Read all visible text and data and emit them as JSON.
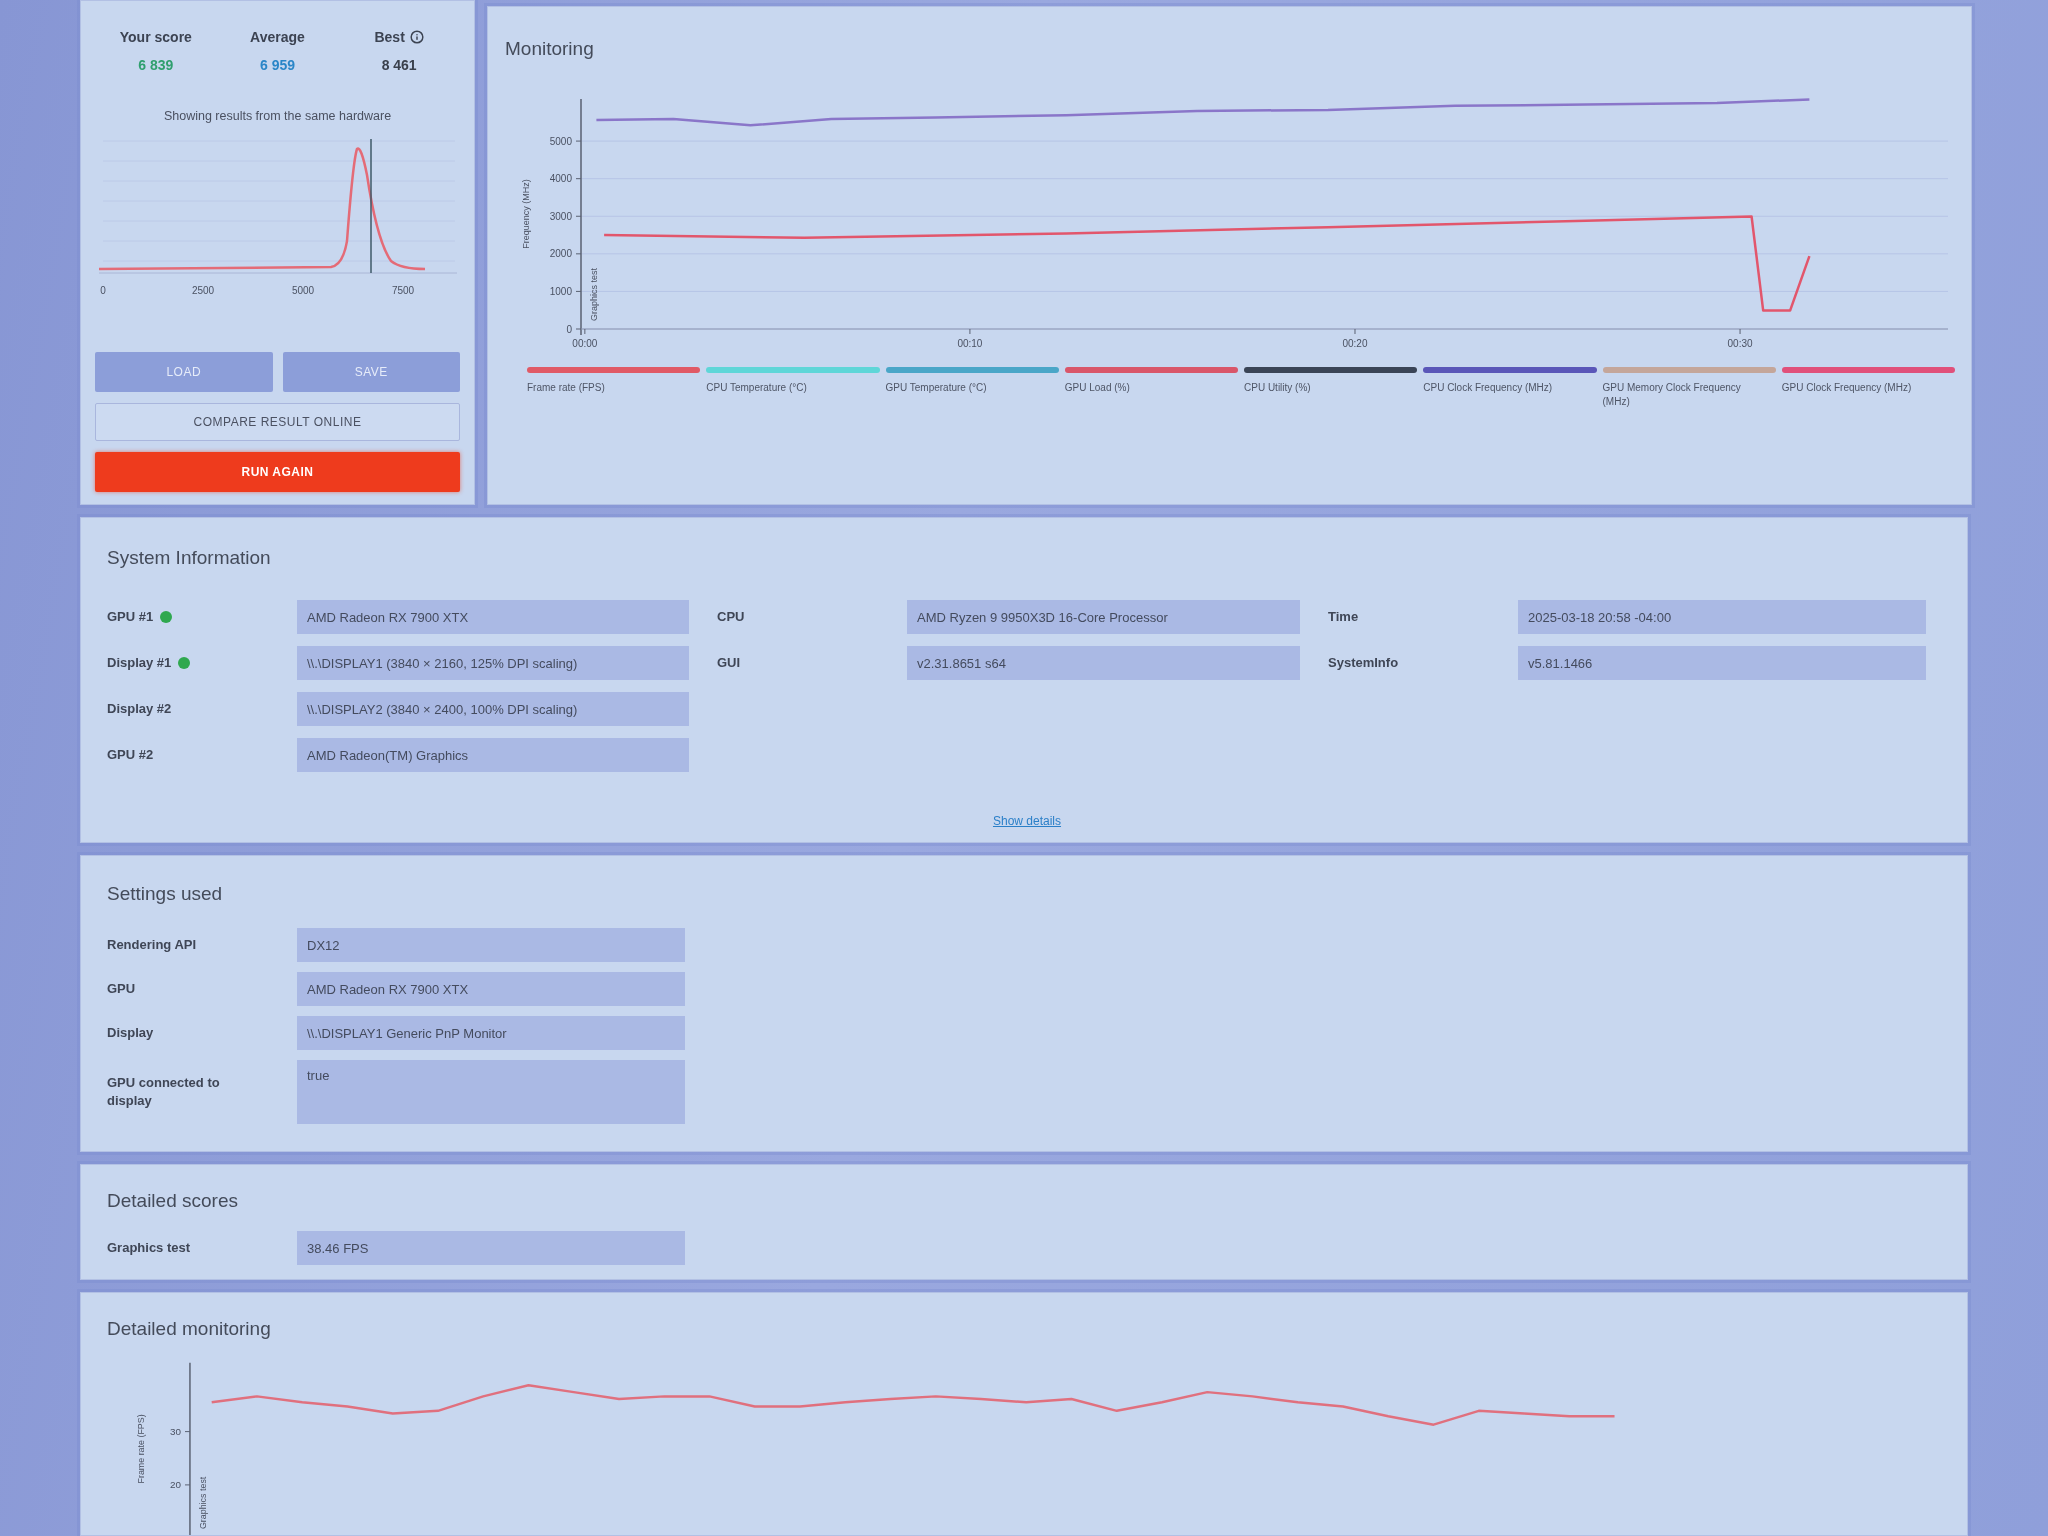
{
  "score_panel": {
    "scores": [
      {
        "kind": "yours",
        "label": "Your score",
        "value": "6 839"
      },
      {
        "kind": "average",
        "label": "Average",
        "value": "6 959"
      },
      {
        "kind": "best",
        "label": "Best",
        "value": "8 461",
        "info": true
      }
    ],
    "distribution": {
      "caption": "Showing results from the same hardware",
      "axis_labels": [
        "0",
        "2500",
        "5000",
        "7500"
      ]
    },
    "buttons": [
      {
        "kind": "secondary",
        "label": "LOAD"
      },
      {
        "kind": "secondary",
        "label": "SAVE"
      },
      {
        "kind": "outline",
        "label": "COMPARE RESULT ONLINE"
      },
      {
        "kind": "primary",
        "label": "RUN AGAIN"
      }
    ]
  },
  "monitoring": {
    "title": "Monitoring",
    "marker_label": "Graphics test",
    "chart_data": {
      "type": "line",
      "ylabel": "Frequency (MHz)",
      "xlim": [
        -0.1,
        35.4
      ],
      "ylim": [
        0,
        6120
      ],
      "xticks": [
        {
          "value": 0,
          "label": "00:00"
        },
        {
          "value": 10,
          "label": "00:10"
        },
        {
          "value": 20,
          "label": "00:20"
        },
        {
          "value": 30,
          "label": "00:30"
        }
      ],
      "yticks": [
        0,
        1000,
        2000,
        3000,
        4000,
        5000
      ],
      "grid": true,
      "series": [
        {
          "color": "#8a76c9",
          "x": [
            0.3,
            2.3,
            4.3,
            6.4,
            9.1,
            12.5,
            15.9,
            19.3,
            22.6,
            26.0,
            29.4,
            31.8
          ],
          "values": [
            5560,
            5590,
            5420,
            5590,
            5630,
            5690,
            5800,
            5830,
            5940,
            5970,
            6010,
            6110
          ]
        },
        {
          "color": "#e2566c",
          "x": [
            0.5,
            5.7,
            12.5,
            19.3,
            26.0,
            30.3,
            30.6,
            31.3,
            31.8
          ],
          "values": [
            2500,
            2430,
            2540,
            2710,
            2880,
            2990,
            490,
            490,
            1940
          ]
        }
      ]
    },
    "legend_items": [
      {
        "label": "Frame rate (FPS)",
        "color": "#e05a66"
      },
      {
        "label": "CPU Temperature (°C)",
        "color": "#5fd6d8"
      },
      {
        "label": "GPU Temperature (°C)",
        "color": "#4aa6c8"
      },
      {
        "label": "GPU Load (%)",
        "color": "#d9566a"
      },
      {
        "label": "CPU Utility (%)",
        "color": "#3a4456"
      },
      {
        "label": "CPU Clock Frequency (MHz)",
        "color": "#5a56b8"
      },
      {
        "label": "GPU Memory Clock Frequency (MHz)",
        "color": "#c4a69a"
      },
      {
        "label": "GPU Clock Frequency (MHz)",
        "color": "#e0507a"
      }
    ]
  },
  "system_information": {
    "title": "System Information",
    "columns": [
      {
        "rows": [
          {
            "label": "GPU #1",
            "value": "AMD Radeon RX 7900 XTX",
            "status_dot": true
          },
          {
            "label": "Display #1",
            "value": "\\\\.\\DISPLAY1 (3840 × 2160, 125% DPI scaling)",
            "status_dot": true
          },
          {
            "label": "Display #2",
            "value": "\\\\.\\DISPLAY2 (3840 × 2400, 100% DPI scaling)"
          },
          {
            "label": "GPU #2",
            "value": "AMD Radeon(TM) Graphics"
          }
        ]
      },
      {
        "rows": [
          {
            "label": "CPU",
            "value": "AMD Ryzen 9 9950X3D 16-Core Processor"
          },
          {
            "label": "GUI",
            "value": "v2.31.8651 s64"
          }
        ]
      },
      {
        "rows": [
          {
            "label": "Time",
            "value": "2025-03-18 20:58 -04:00"
          },
          {
            "label": "SystemInfo",
            "value": "v5.81.1466"
          }
        ]
      }
    ],
    "link": "Show details"
  },
  "settings_used": {
    "title": "Settings used",
    "rows": [
      {
        "label": "Rendering API",
        "value": "DX12"
      },
      {
        "label": "GPU",
        "value": "AMD Radeon RX 7900 XTX"
      },
      {
        "label": "Display",
        "value": "\\\\.\\DISPLAY1 Generic PnP Monitor"
      },
      {
        "label": "GPU connected to display",
        "value": "true"
      }
    ]
  },
  "detailed_scores": {
    "title": "Detailed scores",
    "rows": [
      {
        "label": "Graphics test",
        "value": "38.46 FPS"
      }
    ]
  },
  "detailed_monitoring": {
    "title": "Detailed monitoring",
    "marker_label": "Graphics test",
    "chart_data": {
      "type": "line",
      "ylabel": "Frame rate (FPS)",
      "ylim": [
        10.6,
        42.9
      ],
      "yticks": [
        20,
        30
      ],
      "color": "#e0707e",
      "values": [
        35.5,
        36.6,
        35.5,
        34.7,
        33.4,
        33.9,
        36.6,
        38.7,
        37.4,
        36.1,
        36.6,
        36.6,
        34.7,
        34.7,
        35.5,
        36.1,
        36.6,
        36.1,
        35.5,
        36.1,
        33.9,
        35.5,
        37.4,
        36.6,
        35.5,
        34.7,
        32.9,
        31.3,
        33.9,
        33.4,
        32.9,
        32.9
      ]
    }
  }
}
